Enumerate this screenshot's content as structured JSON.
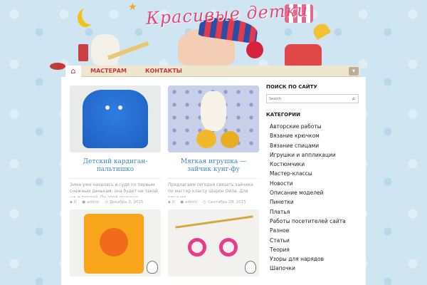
{
  "site": {
    "title": "Красивые детки"
  },
  "nav": {
    "home_icon": "home-icon",
    "items": [
      {
        "label": "МАСТЕРАМ"
      },
      {
        "label": "КОНТАКТЫ"
      }
    ],
    "toggle_icon": "chevron-icon"
  },
  "posts": [
    {
      "title": "Детский кардиган-пальтишко",
      "excerpt": "Зима уже началась и судя по первым снежным денькам, она будет не такой уж и теплой. По этой причине предлагаем...",
      "comments": "0",
      "author": "admin",
      "date": "Декабрь 3, 2015"
    },
    {
      "title": "Мягкая игрушка — зайчик кунг-фу",
      "excerpt": "Предлагаем сегодня связать зайчика по мастер классу Шарон Ойла. Для вязания",
      "comments": "0",
      "author": "admin",
      "date": "Сентябрь 28, 2015"
    },
    {
      "title": "",
      "excerpt": "",
      "comments": "",
      "author": "",
      "date": ""
    },
    {
      "title": "",
      "excerpt": "",
      "comments": "",
      "author": "",
      "date": ""
    }
  ],
  "sidebar": {
    "search_title": "ПОИСК ПО САЙТУ",
    "search_placeholder": "Search",
    "categories_title": "КАТЕГОРИИ",
    "categories": [
      "Авторские работы",
      "Вязание крючком",
      "Вязание спицами",
      "Игрушки и аппликации",
      "Костюмчики",
      "Мастер-классы",
      "Новости",
      "Описание моделей",
      "Пинетки",
      "Платья",
      "Работы посетителей сайта",
      "Разное",
      "Статьи",
      "Теория",
      "Узоры для нарядов",
      "Шапочки"
    ]
  },
  "colors": {
    "accent": "#c43a3a",
    "title_link": "#3d8bb0",
    "nav_bg": "#efe6d0",
    "page_bg": "#cfe6f2"
  }
}
